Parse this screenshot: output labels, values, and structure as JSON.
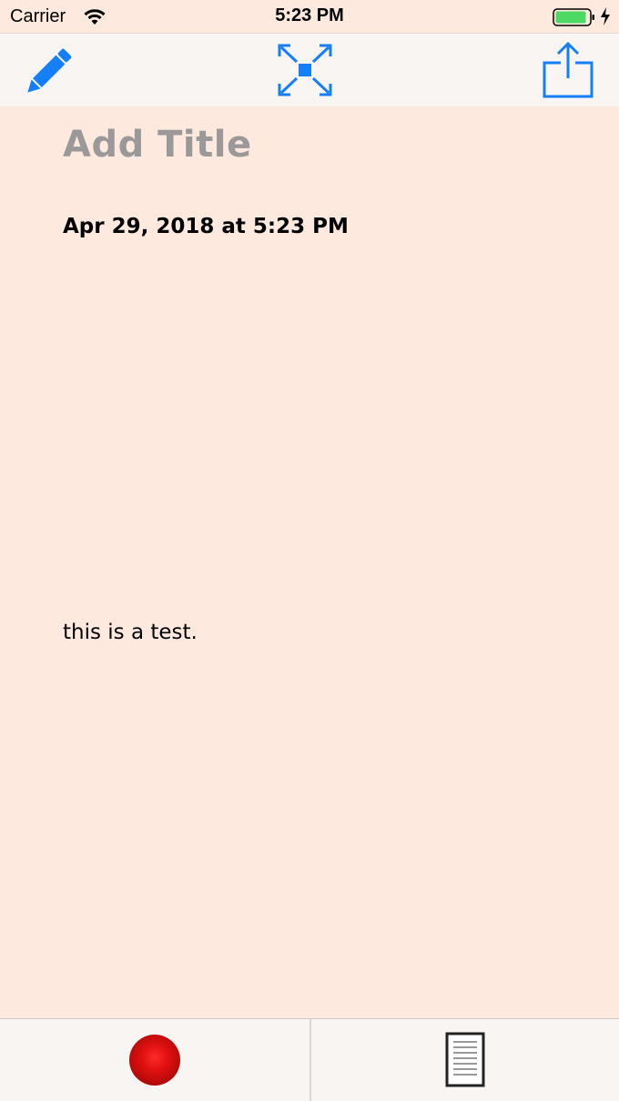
{
  "status_bar": {
    "carrier": "Carrier",
    "time": "5:23 PM",
    "battery_color": "#4cd964"
  },
  "toolbar": {
    "edit_icon": "pencil-icon",
    "expand_icon": "expand-icon",
    "share_icon": "share-icon",
    "accent_color": "#147efb"
  },
  "note": {
    "title_placeholder": "Add Title",
    "date": "Apr 29, 2018 at 5:23 PM",
    "body": "this is a test."
  },
  "bottom_bar": {
    "record_icon": "record-icon",
    "notes_icon": "document-icon"
  },
  "colors": {
    "background": "#fde9de",
    "bar_background": "#f8f5f2"
  }
}
